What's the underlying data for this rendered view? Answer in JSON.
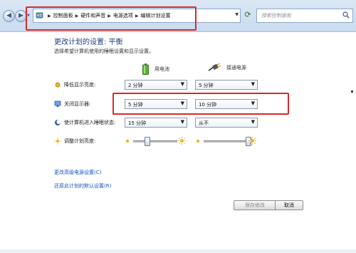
{
  "address_bar": {
    "breadcrumbs": [
      "控制面板",
      "硬件和声音",
      "电源选项",
      "编辑计划设置"
    ],
    "search_placeholder": "搜索控制面板"
  },
  "main": {
    "title": "更改计划的设置: 平衡",
    "subtitle": "选择希望计算机使用的睡眠设置和显示设置。",
    "columns": {
      "battery": "用电池",
      "plugged": "接通电源"
    },
    "rows": [
      {
        "label": "降低显示亮度:",
        "battery": "2 分钟",
        "plugged": "5 分钟"
      },
      {
        "label": "关闭显示器:",
        "battery": "5 分钟",
        "plugged": "10 分钟"
      },
      {
        "label": "使计算机进入睡眠状态:",
        "battery": "15 分钟",
        "plugged": "从不"
      },
      {
        "label": "调整计划亮度:",
        "battery_level": 0.3,
        "plugged_level": 1.0
      }
    ],
    "links": {
      "advanced": "更改高级电源设置(C)",
      "restore": "还原此计划的默认设置(R)"
    },
    "buttons": {
      "save": "保存修改",
      "cancel": "取消"
    }
  },
  "colors": {
    "highlight_box": "#d62a2a",
    "link": "#1552c4",
    "title": "#1f3d80"
  }
}
